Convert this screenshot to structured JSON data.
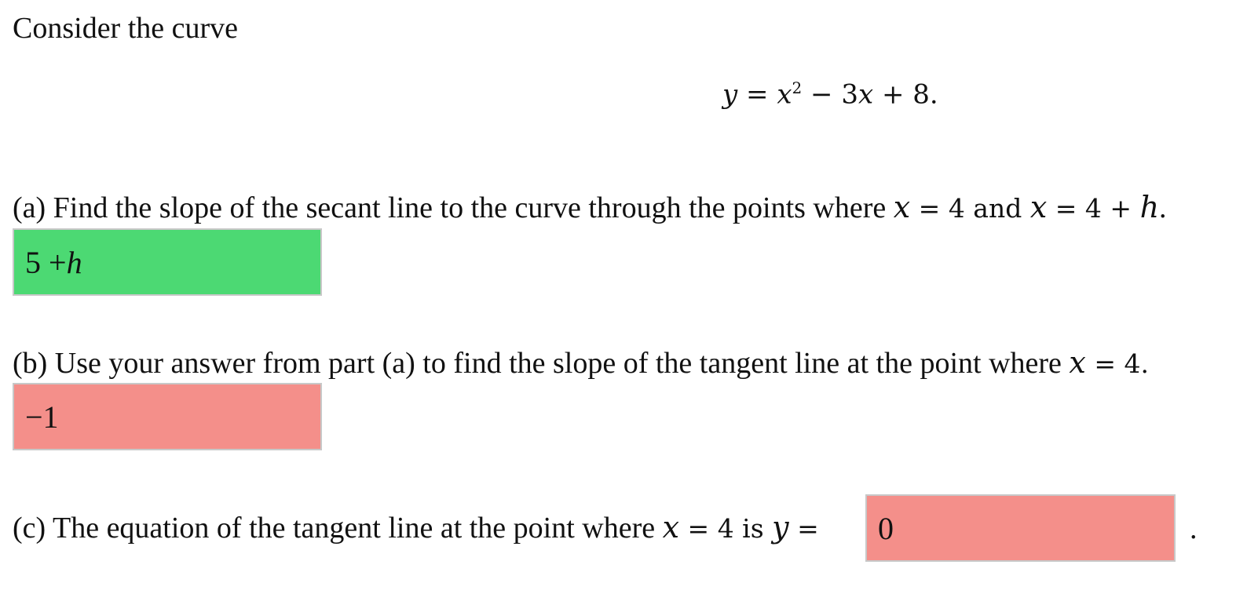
{
  "intro": "Consider the curve",
  "equation": {
    "lhs": "y",
    "eq": " = ",
    "term1": "x",
    "sup": "2",
    "rest": " − 3",
    "x2": "x",
    "end": " + 8."
  },
  "part_a": {
    "prefix": "(a) Find the slope of the secant line to the curve through the points where ",
    "var1": "x",
    "mid1": " = 4 and ",
    "var2": "x",
    "mid2": " = 4 + ",
    "var3": "h",
    "end": ".",
    "answer": "5 + ",
    "answer_var": "h",
    "status": "correct"
  },
  "part_b": {
    "prefix": "(b) Use your answer from part (a) to find the slope of the tangent line at the point where ",
    "var1": "x",
    "end": " = 4.",
    "answer": "−1",
    "status": "incorrect"
  },
  "part_c": {
    "prefix": "(c) The equation of the tangent line at the point where ",
    "var1": "x",
    "mid": " = 4 is ",
    "var2": "y",
    "eq": " =",
    "answer": "0",
    "suffix": ".",
    "status": "incorrect"
  },
  "colors": {
    "correct": "#4cd973",
    "incorrect": "#f48f8a"
  }
}
